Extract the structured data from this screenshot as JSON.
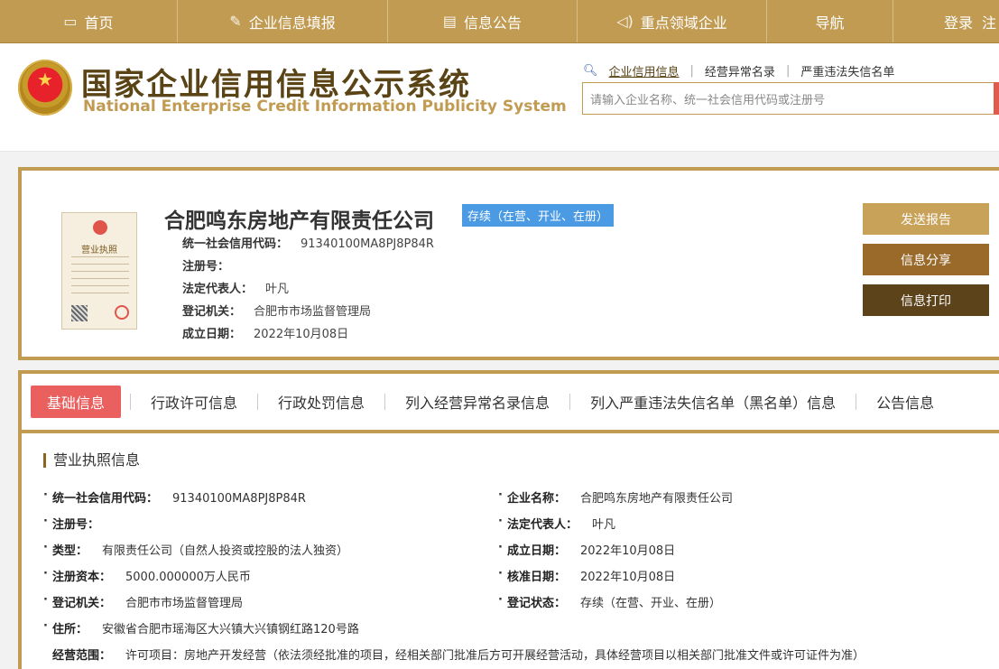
{
  "topnav": {
    "items": [
      {
        "label": "首页",
        "icon": "monitor-icon"
      },
      {
        "label": "企业信息填报",
        "icon": "edit-icon"
      },
      {
        "label": "信息公告",
        "icon": "document-icon"
      },
      {
        "label": "重点领域企业",
        "icon": "speaker-icon"
      },
      {
        "label": "导航",
        "icon": ""
      }
    ],
    "login": "登录",
    "register": "注"
  },
  "header": {
    "title": "国家企业信用信息公示系统",
    "subtitle": "National Enterprise Credit Information Publicity System",
    "search_tabs": [
      "企业信用信息",
      "经营异常名录",
      "严重违法失信名单"
    ],
    "search_placeholder": "请输入企业名称、统一社会信用代码或注册号"
  },
  "company": {
    "name": "合肥鸣东房地产有限责任公司",
    "status": "存续（在营、开业、在册）",
    "license_label": "营业执照",
    "credit_code_label": "统一社会信用代码：",
    "credit_code": "91340100MA8PJ8P84R",
    "reg_no_label": "注册号：",
    "reg_no": "",
    "legal_rep_label": "法定代表人：",
    "legal_rep": "叶凡",
    "authority_label": "登记机关：",
    "authority": "合肥市市场监督管理局",
    "est_date_label": "成立日期：",
    "est_date": "2022年10月08日",
    "buttons": [
      "发送报告",
      "信息分享",
      "信息打印"
    ]
  },
  "tabs": [
    "基础信息",
    "行政许可信息",
    "行政处罚信息",
    "列入经营异常名录信息",
    "列入严重违法失信名单（黑名单）信息",
    "公告信息"
  ],
  "section_title": "营业执照信息",
  "fields": {
    "credit_code": {
      "label": "统一社会信用代码：",
      "value": "91340100MA8PJ8P84R"
    },
    "company_name": {
      "label": "企业名称：",
      "value": "合肥鸣东房地产有限责任公司"
    },
    "reg_no": {
      "label": "注册号：",
      "value": ""
    },
    "legal_rep": {
      "label": "法定代表人：",
      "value": "叶凡"
    },
    "type": {
      "label": "类型：",
      "value": "有限责任公司（自然人投资或控股的法人独资）"
    },
    "est_date": {
      "label": "成立日期：",
      "value": "2022年10月08日"
    },
    "capital": {
      "label": "注册资本：",
      "value": "5000.000000万人民币"
    },
    "approve_date": {
      "label": "核准日期：",
      "value": "2022年10月08日"
    },
    "authority": {
      "label": "登记机关：",
      "value": "合肥市市场监督管理局"
    },
    "reg_status": {
      "label": "登记状态：",
      "value": "存续（在营、开业、在册）"
    },
    "address": {
      "label": "住所：",
      "value": "安徽省合肥市瑶海区大兴镇大兴镇钢红路120号路"
    },
    "scope": {
      "label": "经营范围：",
      "value": "许可项目：房地产开发经营（依法须经批准的项目，经相关部门批准后方可开展经营活动，具体经营项目以相关部门批准文件或许可证件为准）"
    }
  },
  "colors": {
    "gold": "#c19b52",
    "dark_brown": "#5a4416",
    "active_tab": "#e9605e",
    "status_blue": "#4a9ae4"
  }
}
